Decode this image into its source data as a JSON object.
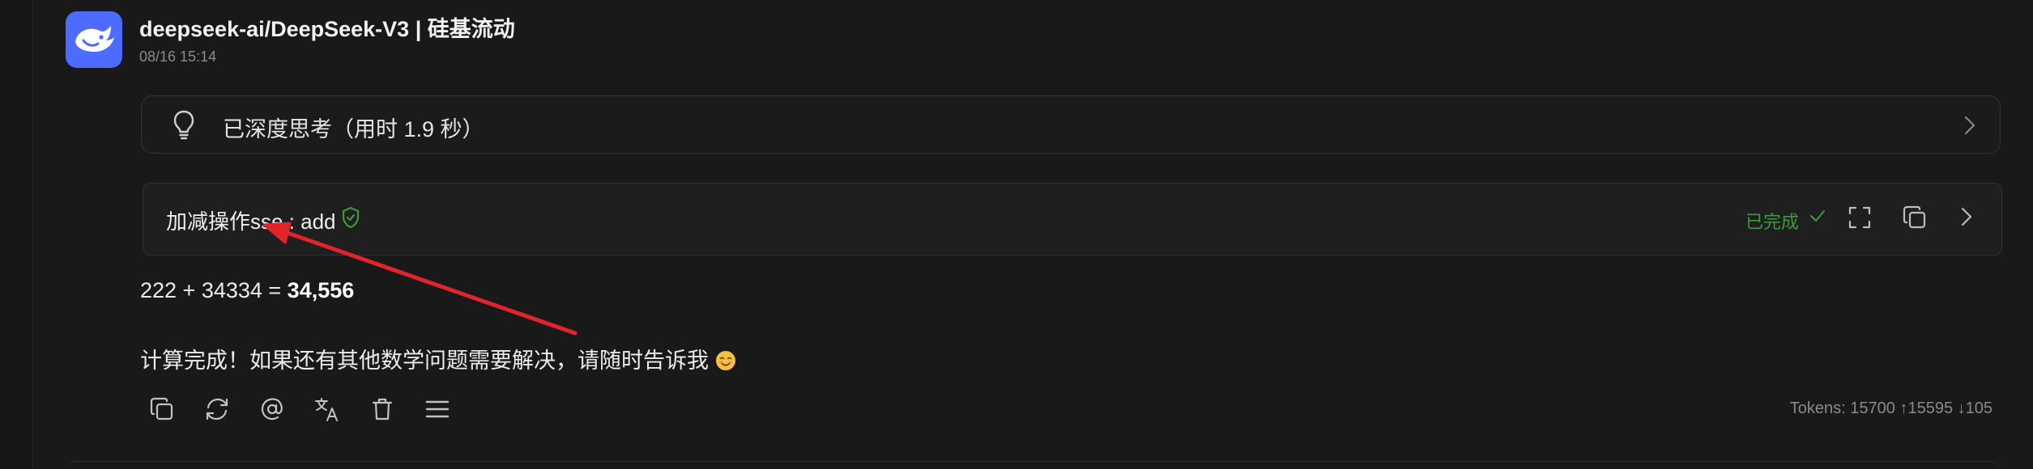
{
  "message": {
    "sender": "deepseek-ai/DeepSeek-V3 | 硅基流动",
    "timestamp": "08/16 15:14",
    "avatar_icon": "whale-icon",
    "avatar_color": "#4d6bfe"
  },
  "thinking": {
    "label": "已深度思考（用时 1.9 秒）",
    "icon": "lightbulb-icon"
  },
  "tool_call": {
    "name": "加减操作sse : add",
    "status": "已完成",
    "status_color": "#3d9a3d"
  },
  "response": {
    "expression": "222 + 34334 = ",
    "result": "34,556",
    "followup": "计算完成！如果还有其他数学问题需要解决，请随时告诉我",
    "emoji_icon": "smiling-face-icon"
  },
  "actions": [
    {
      "name": "copy-button",
      "icon": "copy-icon"
    },
    {
      "name": "regenerate-button",
      "icon": "refresh-icon"
    },
    {
      "name": "mention-button",
      "icon": "at-icon"
    },
    {
      "name": "translate-button",
      "icon": "translate-icon"
    },
    {
      "name": "delete-button",
      "icon": "trash-icon"
    },
    {
      "name": "menu-button",
      "icon": "menu-icon"
    }
  ],
  "tokens": {
    "text": "Tokens: 15700 ↑15595 ↓105"
  },
  "annotation": {
    "arrow_color": "#e0242b"
  }
}
